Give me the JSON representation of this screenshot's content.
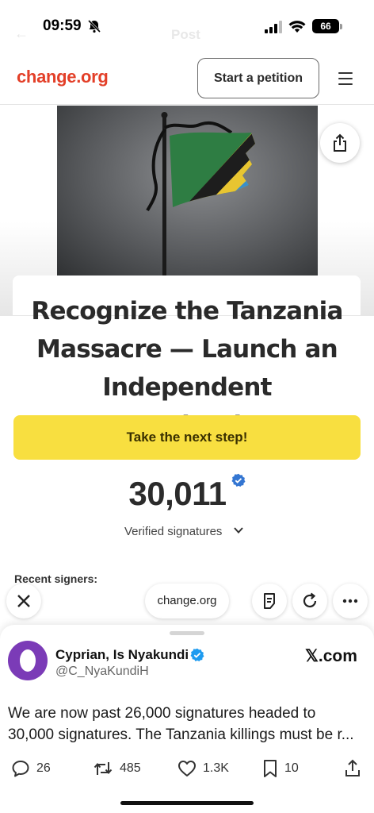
{
  "status_bar": {
    "time": "09:59",
    "battery": "66",
    "ghost_back": "←",
    "ghost_title": "Post"
  },
  "header": {
    "logo": "change.org",
    "start_petition_label": "Start a petition",
    "brand_color": "#e33f28"
  },
  "petition": {
    "title": "Recognize the Tanzania Massacre — Launch an Independent Investigation",
    "cta_label": "Take the next step!",
    "signature_count": "30,011",
    "signatures_label": "Verified signatures",
    "recent_signers_label": "Recent signers:",
    "cta_color": "#f8df40"
  },
  "browser_toolbar": {
    "url": "change.org",
    "buttons": [
      "close-icon",
      "page-icon",
      "reload-icon",
      "more-icon"
    ]
  },
  "tweet": {
    "author_name": "Cyprian, Is Nyakundi",
    "author_handle": "@C_NyaKundiH",
    "source": "𝕏.com",
    "text_line1": "We are now past 26,000 signatures headed to",
    "text_line2": "30,000 signatures. The Tanzania killings must be r...",
    "replies": "26",
    "reposts": "485",
    "likes": "1.3K",
    "bookmarks": "10",
    "avatar_color": "#7b3bb7"
  }
}
